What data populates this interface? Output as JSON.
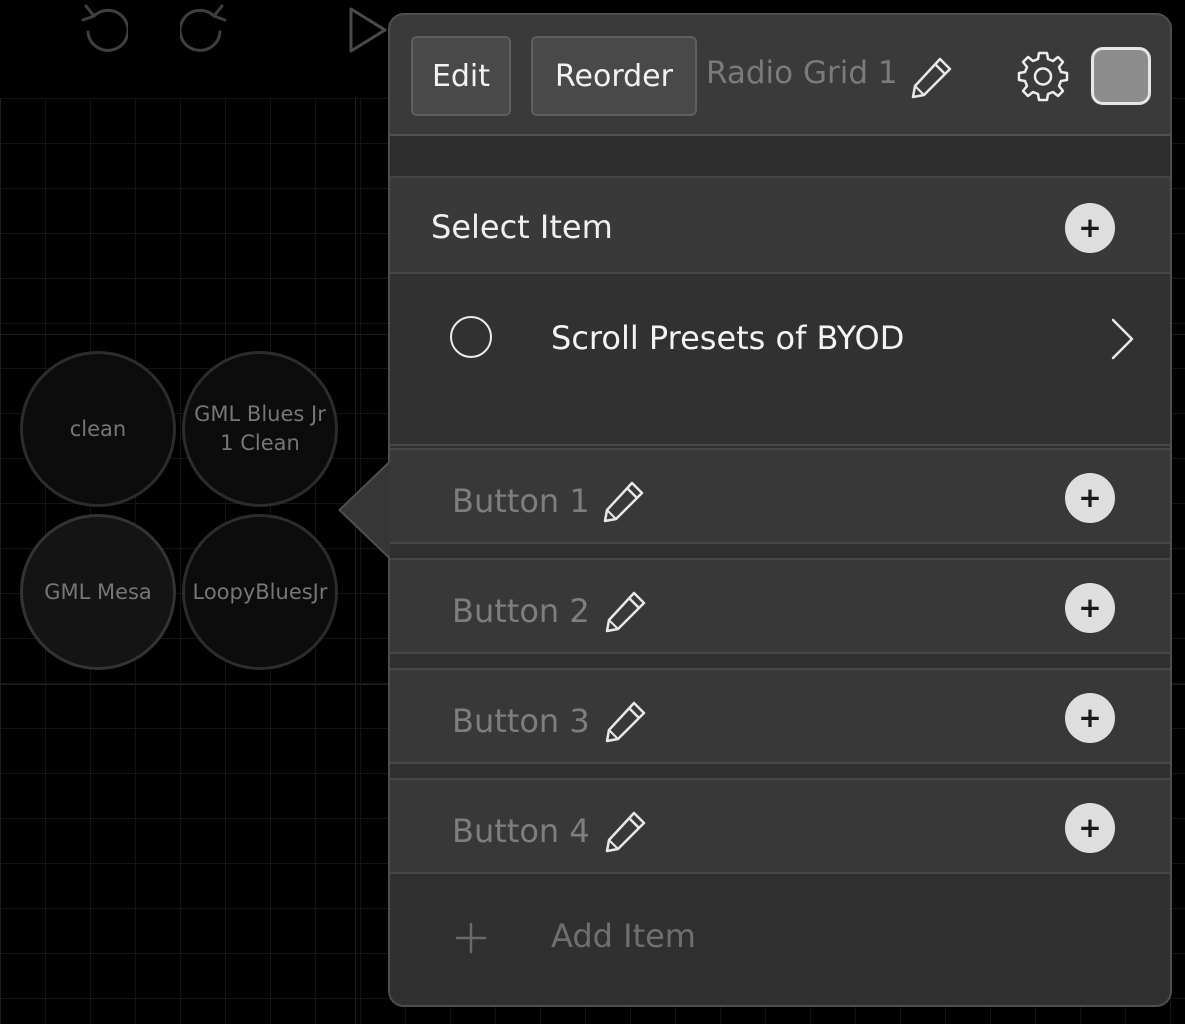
{
  "toolbar": {
    "undo_icon": "undo-icon",
    "redo_icon": "redo-icon",
    "play_icon": "play-icon"
  },
  "radio_grid": {
    "buttons": [
      {
        "label": "clean",
        "selected": false
      },
      {
        "label": "GML Blues Jr\n1 Clean",
        "selected": false
      },
      {
        "label": "GML Mesa",
        "selected": true
      },
      {
        "label": "LoopyBluesJr",
        "selected": false
      }
    ]
  },
  "popover": {
    "header": {
      "edit_label": "Edit",
      "reorder_label": "Reorder",
      "title": "Radio Grid 1",
      "swatch_color": "#8d8d8d"
    },
    "select_section": {
      "title": "Select Item"
    },
    "items": [
      {
        "name": "Scroll Presets of BYOD"
      }
    ],
    "buttons": [
      {
        "name": "Button 1"
      },
      {
        "name": "Button 2"
      },
      {
        "name": "Button 3"
      },
      {
        "name": "Button 4"
      }
    ],
    "add_item_label": "Add Item"
  },
  "colors": {
    "background": "#000000",
    "panel": "#303030",
    "header": "#3a3a3a",
    "text_primary": "#f0f0f0",
    "text_muted": "#7e7e7e"
  }
}
